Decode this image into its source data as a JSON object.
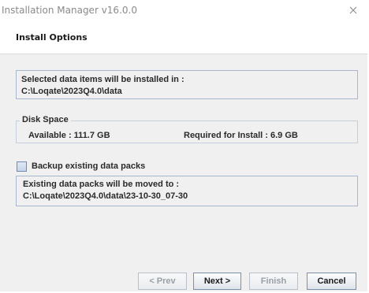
{
  "window": {
    "title": "Installation Manager v16.0.0"
  },
  "header": {
    "section_title": "Install Options"
  },
  "install_location": {
    "label": "Selected data items will be installed in :",
    "path": "C:\\Loqate\\2023Q4.0\\data"
  },
  "disk_space": {
    "legend": "Disk Space",
    "available": "Available : 111.7 GB",
    "required": "Required for Install : 6.9 GB"
  },
  "backup": {
    "checkbox_label": "Backup existing data packs",
    "checked": false,
    "moved_label": "Existing data packs will be moved to :",
    "moved_path": "C:\\Loqate\\2023Q4.0\\data\\23-10-30_07-30"
  },
  "buttons": {
    "prev": "< Prev",
    "next": "Next >",
    "finish": "Finish",
    "cancel": "Cancel"
  },
  "colors": {
    "content_background": "#f0f0f0",
    "box_border": "#a8b8cc",
    "disabled_text": "#9aa0a8"
  },
  "icons": {
    "close": "close-icon"
  }
}
